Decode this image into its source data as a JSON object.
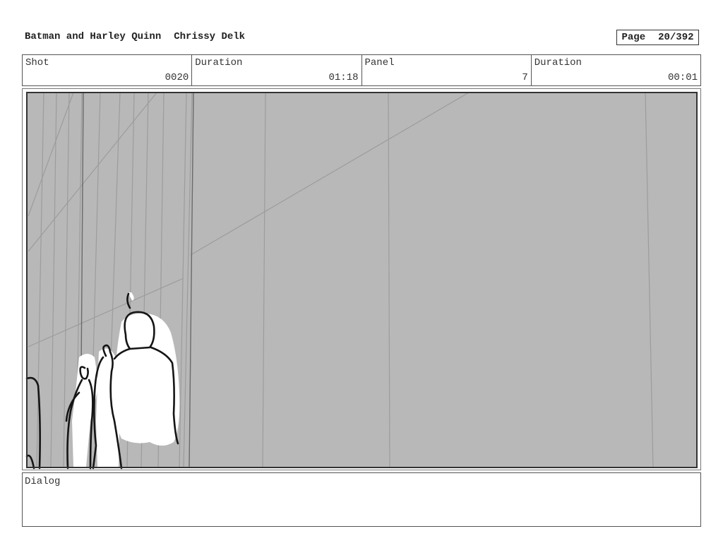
{
  "header": {
    "project": "Batman and Harley Quinn",
    "artist": "Chrissy Delk",
    "page_label": "Page",
    "page_number": "20/392"
  },
  "info": {
    "shot_label": "Shot",
    "shot_value": "0020",
    "shot_duration_label": "Duration",
    "shot_duration_value": "01:18",
    "panel_label": "Panel",
    "panel_value": "7",
    "panel_duration_label": "Duration",
    "panel_duration_value": "00:01"
  },
  "panel": {
    "background_color": "#b8b8b8",
    "sketch_line_color": "#9a9a9a",
    "ink_color": "#151515"
  },
  "dialog": {
    "label": "Dialog"
  }
}
